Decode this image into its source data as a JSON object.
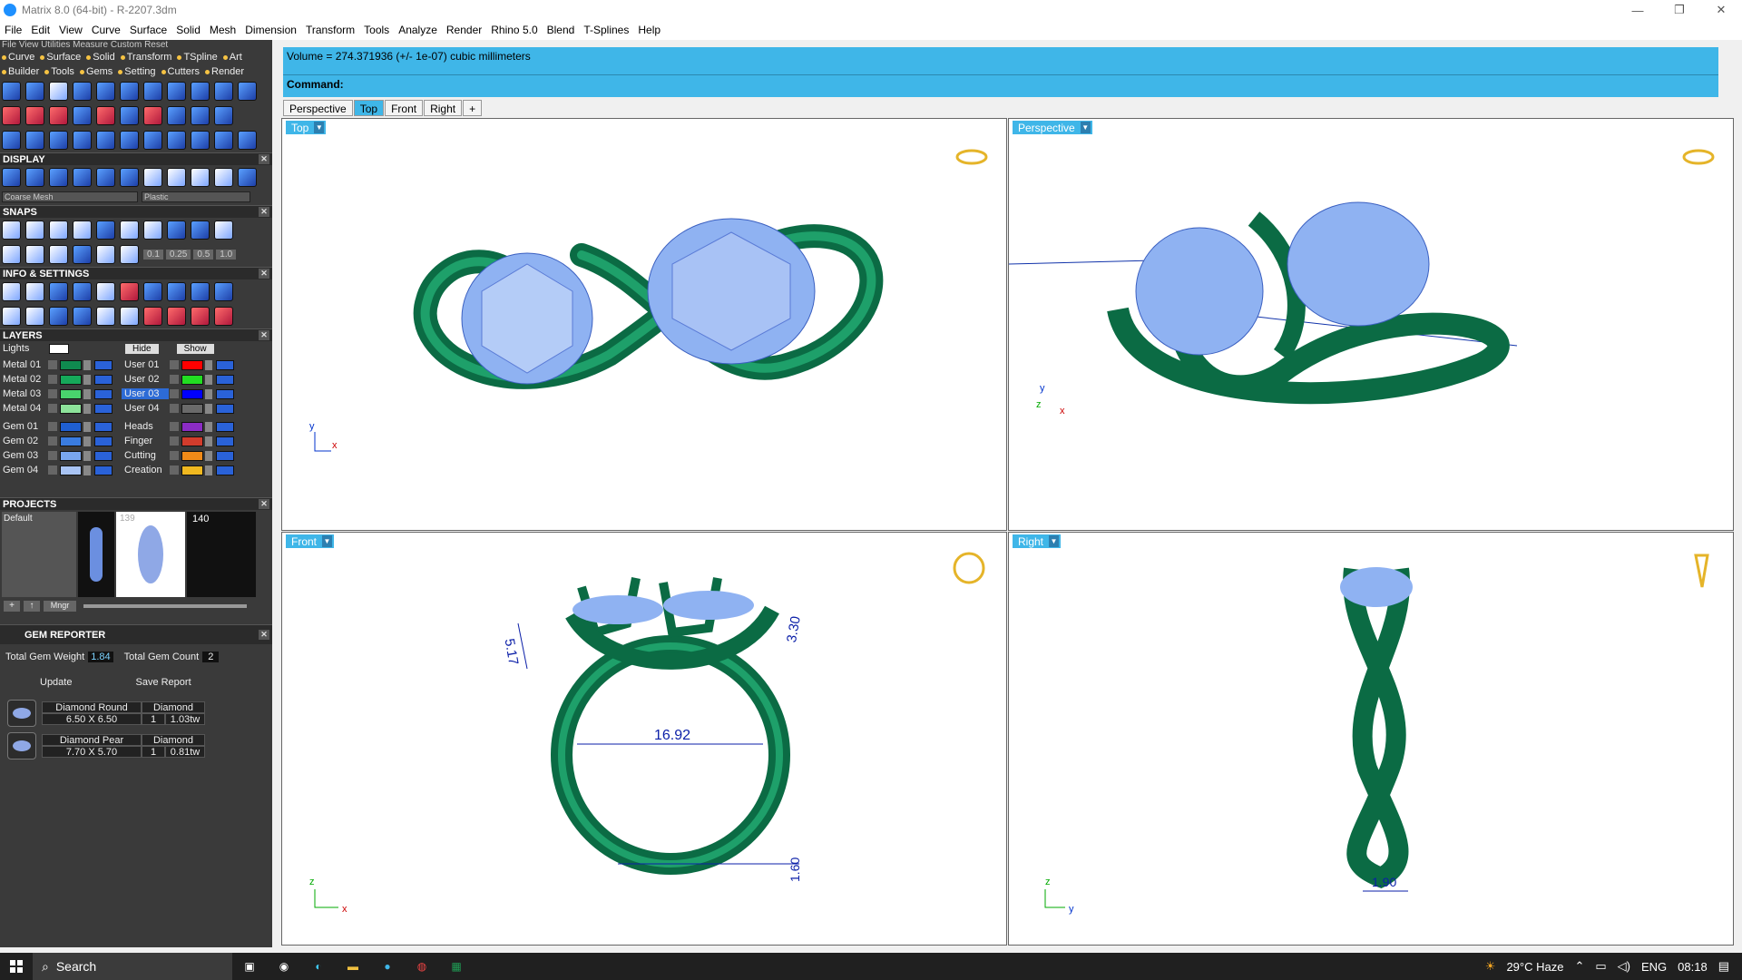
{
  "window": {
    "title": "Matrix 8.0 (64-bit) - R-2207.3dm"
  },
  "menu": [
    "File",
    "Edit",
    "View",
    "Curve",
    "Surface",
    "Solid",
    "Mesh",
    "Dimension",
    "Transform",
    "Tools",
    "Analyze",
    "Render",
    "Rhino 5.0",
    "Blend",
    "T-Splines",
    "Help"
  ],
  "panel": {
    "top_menu": "File  View  Utilities  Measure  Custom    Reset",
    "tabs1": [
      "Curve",
      "Surface",
      "Solid",
      "Transform",
      "TSpline",
      "Art"
    ],
    "tabs2": [
      "Builder",
      "Tools",
      "Gems",
      "Setting",
      "Cutters",
      "Render"
    ],
    "display": {
      "title": "DISPLAY",
      "mesh": "Coarse Mesh",
      "material": "Plastic"
    },
    "snaps": {
      "title": "SNAPS",
      "values": [
        "0.1",
        "0.25",
        "0.5",
        "1.0"
      ]
    },
    "info": {
      "title": "INFO & SETTINGS"
    },
    "layers": {
      "title": "LAYERS",
      "lights": "Lights",
      "hide": "Hide",
      "show": "Show",
      "left": [
        {
          "name": "Metal 01",
          "color": "#0f8a4f"
        },
        {
          "name": "Metal 02",
          "color": "#16a85a"
        },
        {
          "name": "Metal 03",
          "color": "#49d36d"
        },
        {
          "name": "Metal 04",
          "color": "#8de39a"
        },
        {
          "name": "Gem 01",
          "color": "#1f5fd1"
        },
        {
          "name": "Gem 02",
          "color": "#3a7ce0"
        },
        {
          "name": "Gem 03",
          "color": "#79a6ef"
        },
        {
          "name": "Gem 04",
          "color": "#a9c4f4"
        }
      ],
      "right": [
        {
          "name": "User 01",
          "color": "#ff0000"
        },
        {
          "name": "User 02",
          "color": "#22dd22"
        },
        {
          "name": "User 03",
          "color": "#0000ff"
        },
        {
          "name": "User 04",
          "color": "#6a6a6a"
        },
        {
          "name": "Heads",
          "color": "#8b2cc4"
        },
        {
          "name": "Finger",
          "color": "#d23c2c"
        },
        {
          "name": "Cutting",
          "color": "#f08a18"
        },
        {
          "name": "Creation",
          "color": "#f0b820"
        }
      ]
    },
    "projects": {
      "title": "PROJECTS",
      "default": "Default",
      "thumb_a": "139",
      "thumb_b": "140",
      "mngr": "Mngr"
    },
    "gem_reporter": {
      "title": "GEM REPORTER",
      "weight_label": "Total Gem Weight",
      "weight": "1.84",
      "count_label": "Total Gem Count",
      "count": "2",
      "update": "Update",
      "save": "Save Report",
      "gems": [
        {
          "name": "Diamond Round",
          "type": "Diamond",
          "size": "6.50 X 6.50",
          "qty": "1",
          "ct": "1.03tw"
        },
        {
          "name": "Diamond Pear",
          "type": "Diamond",
          "size": "7.70 X 5.70",
          "qty": "1",
          "ct": "0.81tw"
        }
      ]
    }
  },
  "command": {
    "output": "Volume = 274.371936 (+/- 1e-07) cubic millimeters",
    "label": "Command:"
  },
  "viewtabs": [
    "Perspective",
    "Top",
    "Front",
    "Right"
  ],
  "viewports": {
    "top": "Top",
    "persp": "Perspective",
    "front": "Front",
    "right": "Right"
  },
  "dims": {
    "d1": "5.17",
    "d2": "3.30",
    "d3": "16.92",
    "d4": "1.60",
    "d5": "1.90"
  },
  "axes": {
    "x": "x",
    "y": "y",
    "z": "z"
  },
  "taskbar": {
    "search": "Search",
    "weather": "29°C  Haze",
    "lang": "ENG",
    "time": "08:18"
  }
}
